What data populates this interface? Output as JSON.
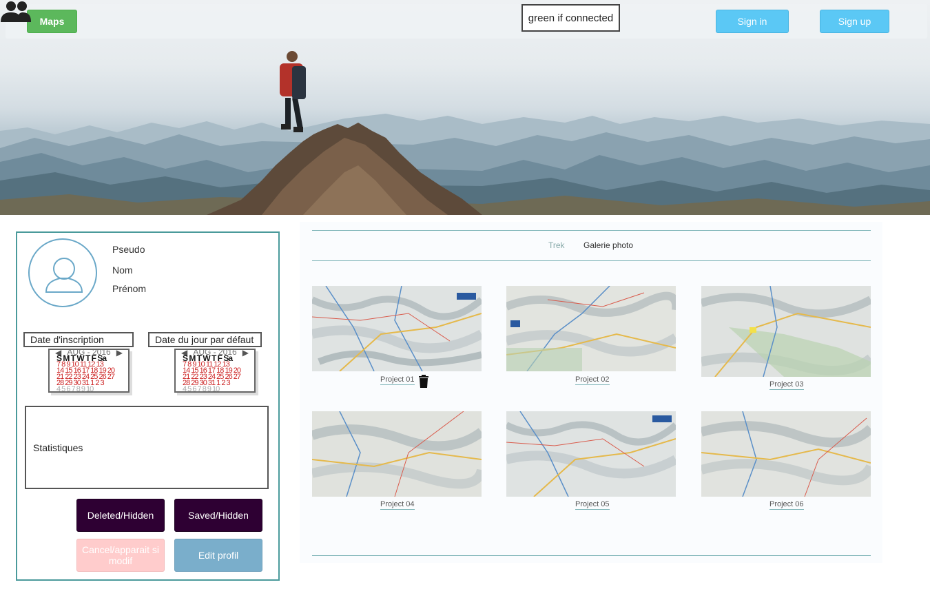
{
  "header": {
    "maps_button": "Maps",
    "connection_status": "green if connected",
    "sign_in_button": "Sign in",
    "sign_up_button": "Sign up"
  },
  "profile": {
    "fields": [
      "Pseudo",
      "Nom",
      "Prénom"
    ],
    "registration_date_label": "Date d'inscription",
    "default_date_label": "Date du jour par défaut",
    "calendar": {
      "month_label": "AUG - 2016",
      "day_names": "S M T W T F Sa",
      "rows": [
        "7 8 9 10 11 12 13",
        "14 15 16 17 18 19 20",
        "21 22 23 24 25 26 27",
        "28 29 30 31 1 2 3",
        "4 5 6 7 8 9 10"
      ]
    },
    "statistics_label": "Statistiques",
    "buttons": {
      "deleted_hidden": "Deleted/Hidden",
      "saved_hidden": "Saved/Hidden",
      "cancel": "Cancel/apparait si modif",
      "edit_profile": "Edit profil"
    },
    "colors": {
      "border": "#4a9a9b",
      "dark_button": "#2e0033",
      "cancel_button": "#ffcccc",
      "edit_button": "#7aaecb"
    }
  },
  "gallery": {
    "tabs": [
      "Trek",
      "Galerie photo"
    ],
    "projects": [
      "Project 01",
      "Project 02",
      "Project 03",
      "Project 04",
      "Project 05",
      "Project 06"
    ],
    "delete_icon": "trash-icon"
  },
  "colors": {
    "maps_button": "#5cb85c",
    "auth_buttons": "#5bc8f5",
    "divider": "#7fb5b8"
  }
}
